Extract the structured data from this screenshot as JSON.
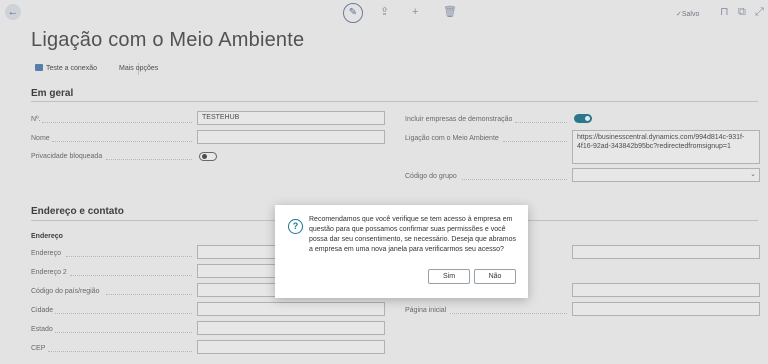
{
  "header": {
    "back_icon": "arrow-left-icon",
    "edit_icon": "pencil-icon",
    "share_icon": "share-icon",
    "new_icon": "plus-icon",
    "delete_icon": "trash-icon",
    "saved_label": "✓Salvo",
    "bookmark_icon": "bookmark-icon",
    "popout_icon": "open-new-window-icon",
    "expand_icon": "expand-icon"
  },
  "page": {
    "title": "Ligação com o Meio Ambiente"
  },
  "actions": {
    "test_connection": "Teste a conexão",
    "more_options": "Mais opções"
  },
  "general": {
    "title": "Em geral",
    "no_label": "Nº.",
    "no_value": "TESTEHUB",
    "name_label": "Nome",
    "name_value": "",
    "privacy_label": "Privacidade bloqueada",
    "privacy_on": false,
    "include_demo_label": "Incluir empresas de demonstração",
    "include_demo_on": true,
    "env_link_label": "Ligação com o Meio Ambiente",
    "env_link_value": "https://businesscentral.dynamics.com/994d814c-931f-4f16-92ad-343842b95bc?redirectedfromsignup=1",
    "group_code_label": "Código do grupo",
    "group_code_value": ""
  },
  "address": {
    "title": "Endereço e contato",
    "subtitle": "Endereço",
    "address_label": "Endereço",
    "address2_label": "Endereço 2",
    "country_label": "Código do país/região",
    "city_label": "Cidade",
    "state_label": "Estado",
    "zip_label": "CEP",
    "homepage_label": "Página inicial"
  },
  "dialog": {
    "icon": "question-icon",
    "message": "Recomendamos que você verifique se tem acesso à empresa em questão para que possamos confirmar suas permissões e você possa dar seu consentimento, se necessário. Deseja que abramos a empresa em uma nova janela para verificarmos seu acesso?",
    "yes_label": "Sim",
    "no_label": "Não"
  },
  "colors": {
    "accent": "#1a7890",
    "toolbar_icon": "#8a97ad"
  }
}
